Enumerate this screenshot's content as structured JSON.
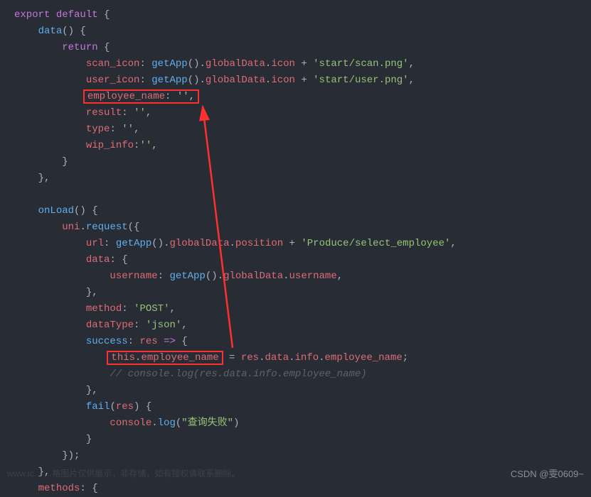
{
  "code": {
    "line1_export": "export",
    "line1_default": "default",
    "line1_brace": " {",
    "line2_data": "data",
    "line2_rest": "() {",
    "line3_return": "return",
    "line3_rest": " {",
    "line4_key": "scan_icon",
    "line4_colon": ": ",
    "line4_fn": "getApp",
    "line4_p1": "().",
    "line4_gd": "globalData",
    "line4_dot": ".",
    "line4_icon": "icon",
    "line4_plus": " + ",
    "line4_str": "'start/scan.png'",
    "line4_end": ",",
    "line5_key": "user_icon",
    "line5_str": "'start/user.png'",
    "line6_key": "employee_name",
    "line6_colon": ": ",
    "line6_str": "''",
    "line6_end": ",",
    "line7_key": "result",
    "line7_str": "''",
    "line8_key": "type",
    "line8_str": "''",
    "line9_key": "wip_info",
    "line9_str": "''",
    "line10": "}",
    "line11": "},",
    "line13_onload": "onLoad",
    "line13_rest": "() {",
    "line14_uni": "uni",
    "line14_dot": ".",
    "line14_req": "request",
    "line14_rest": "({",
    "line15_key": "url",
    "line15_fn": "getApp",
    "line15_p1": "().",
    "line15_gd": "globalData",
    "line15_dot": ".",
    "line15_pos": "position",
    "line15_plus": " + ",
    "line15_str": "'Produce/select_employee'",
    "line15_end": ",",
    "line16_key": "data",
    "line16_rest": ": {",
    "line17_key": "username",
    "line17_fn": "getApp",
    "line17_un": "username",
    "line18": "},",
    "line19_key": "method",
    "line19_str": "'POST'",
    "line20_key": "dataType",
    "line20_str": "'json'",
    "line21_key": "success",
    "line21_res": "res",
    "line21_arrow": " => ",
    "line21_rest": "{",
    "line22_this": "this",
    "line22_dot": ".",
    "line22_emp": "employee_name",
    "line22_eq": " = ",
    "line22_res": "res",
    "line22_data": "data",
    "line22_info": "info",
    "line22_en": "employee_name",
    "line22_end": ";",
    "line23_comment": "// console.log(res.data.info.employee_name)",
    "line24": "},",
    "line25_fail": "fail",
    "line25_res": "res",
    "line25_rest": ") {",
    "line26_console": "console",
    "line26_log": "log",
    "line26_str": "\"查询失败\"",
    "line27": "}",
    "line28": "});",
    "line29": "},",
    "line30_methods": "methods",
    "line30_rest": ": {"
  },
  "watermark": "CSDN @雯0609~",
  "faint": "www.tc...  …格图片仅供展示，非存储，如有授权请联系删除。"
}
